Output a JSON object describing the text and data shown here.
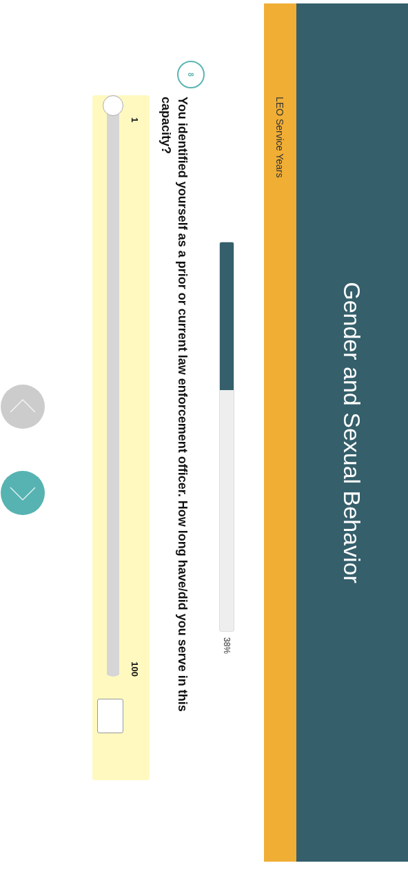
{
  "header": {
    "title": "Gender and Sexual Behavior"
  },
  "section_bar": {
    "label": "LEO Service Years"
  },
  "progress": {
    "level": 0.38,
    "label": "38%"
  },
  "question": {
    "number": "8",
    "text": "You identified yourself as a prior or current law enforcement officer. How long have/did you serve in this capacity?"
  },
  "slider": {
    "min_label": "1",
    "max_label": "100",
    "level": 0
  },
  "nav": [
    {
      "kind": "up",
      "disabled": true
    },
    {
      "kind": "down",
      "disabled": false
    }
  ]
}
